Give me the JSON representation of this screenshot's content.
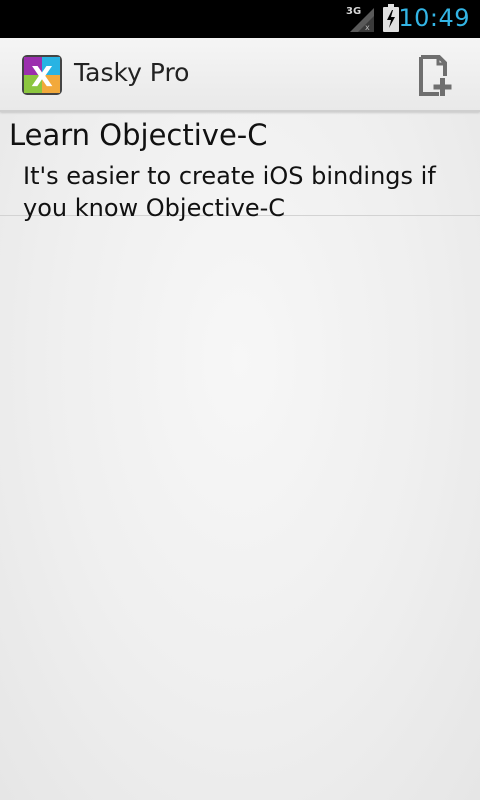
{
  "status_bar": {
    "network": "3G",
    "time": "10:49",
    "accent_color": "#33b5e5",
    "icons": [
      "signal-icon",
      "battery-charging-icon"
    ]
  },
  "action_bar": {
    "app_icon": "xamarin-logo-icon",
    "title": "Tasky Pro",
    "add_icon": "new-document-plus-icon"
  },
  "tasks": [
    {
      "title": "Learn Objective-C",
      "notes": "It's easier to create iOS bindings if you know Objective-C"
    }
  ]
}
